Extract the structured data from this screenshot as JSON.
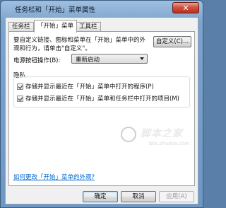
{
  "window": {
    "title": "任务栏和「开始」菜单属性",
    "close_label": "✕"
  },
  "tabs": [
    {
      "label": "任务栏",
      "active": false
    },
    {
      "label": "「开始」菜单",
      "active": true
    },
    {
      "label": "工具栏",
      "active": false
    }
  ],
  "panel": {
    "description": "要自定义链接、图标和菜单在「开始」菜单中的外观和行为，请单击\"自定义\"。",
    "customize_button": "自定义(C)...",
    "power_label": "电源按钮操作(B):",
    "power_value": "重新启动",
    "privacy": {
      "title": "隐私",
      "items": [
        {
          "label": "存储并显示最近在「开始」菜单中打开的程序(P)",
          "checked": true
        },
        {
          "label": "存储并显示最近在「开始」菜单和任务栏中打开的项目(M)",
          "checked": true
        }
      ]
    },
    "help_link": "如何更改「开始」菜单的外观?"
  },
  "buttons": {
    "ok": "确定",
    "cancel": "取消",
    "apply": "应用(A)"
  },
  "watermark": {
    "text": "脚本之家",
    "sub": "bbs.shudoo.com"
  },
  "colors": {
    "title_bar": "#7ea4cc",
    "close_button": "#c7432f",
    "link": "#0066cc"
  }
}
